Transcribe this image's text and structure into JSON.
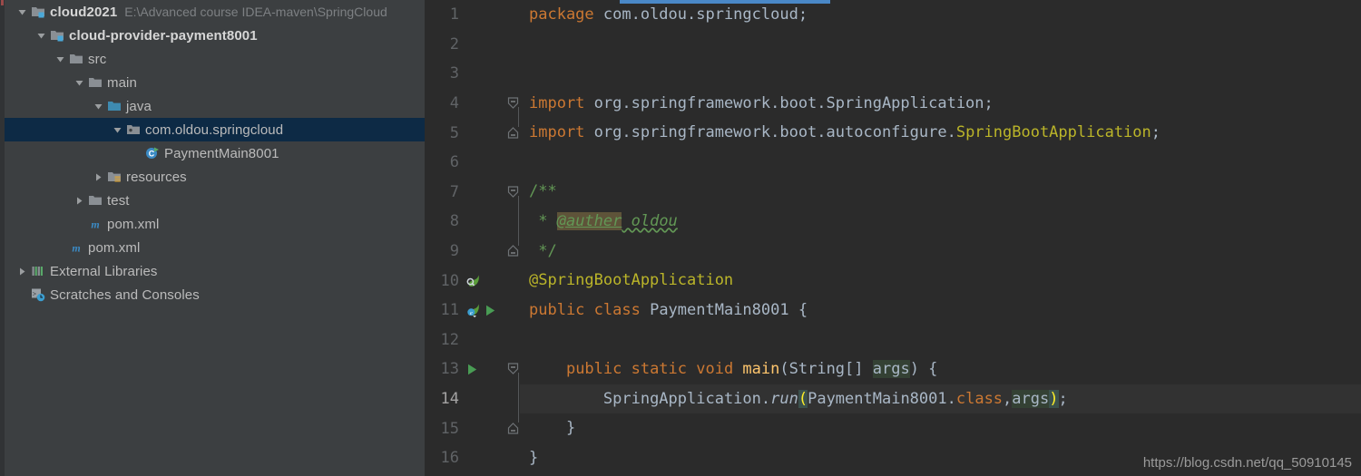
{
  "project_tree": {
    "items": [
      {
        "label": "cloud2021",
        "path": "E:\\Advanced course IDEA-maven\\SpringCloud",
        "icon": "module-folder-icon",
        "twisty": "expanded",
        "depth": 0,
        "bold": true,
        "selected": false
      },
      {
        "label": "cloud-provider-payment8001",
        "path": "",
        "icon": "module-folder-icon",
        "twisty": "expanded",
        "depth": 1,
        "bold": true,
        "selected": false
      },
      {
        "label": "src",
        "path": "",
        "icon": "folder-icon",
        "twisty": "expanded",
        "depth": 2,
        "bold": false,
        "selected": false
      },
      {
        "label": "main",
        "path": "",
        "icon": "folder-icon",
        "twisty": "expanded",
        "depth": 3,
        "bold": false,
        "selected": false
      },
      {
        "label": "java",
        "path": "",
        "icon": "source-root-folder-icon",
        "twisty": "expanded",
        "depth": 4,
        "bold": false,
        "selected": false
      },
      {
        "label": "com.oldou.springcloud",
        "path": "",
        "icon": "package-icon",
        "twisty": "expanded",
        "depth": 5,
        "bold": false,
        "selected": true
      },
      {
        "label": "PaymentMain8001",
        "path": "",
        "icon": "java-class-runnable-icon",
        "twisty": "none",
        "depth": 6,
        "bold": false,
        "selected": false
      },
      {
        "label": "resources",
        "path": "",
        "icon": "resources-folder-icon",
        "twisty": "collapsed",
        "depth": 4,
        "bold": false,
        "selected": false
      },
      {
        "label": "test",
        "path": "",
        "icon": "folder-icon",
        "twisty": "collapsed",
        "depth": 3,
        "bold": false,
        "selected": false
      },
      {
        "label": "pom.xml",
        "path": "",
        "icon": "maven-icon",
        "twisty": "none",
        "depth": 3,
        "bold": false,
        "selected": false
      },
      {
        "label": "pom.xml",
        "path": "",
        "icon": "maven-icon",
        "twisty": "none",
        "depth": 2,
        "bold": false,
        "selected": false
      },
      {
        "label": "External Libraries",
        "path": "",
        "icon": "libraries-icon",
        "twisty": "collapsed",
        "depth": 0,
        "bold": false,
        "selected": false
      },
      {
        "label": "Scratches and Consoles",
        "path": "",
        "icon": "scratches-icon",
        "twisty": "none",
        "depth": 0,
        "bold": false,
        "selected": false
      }
    ]
  },
  "editor": {
    "active_tab_indicator_color": "#4a88c7",
    "caret_line": 14,
    "lines": [
      {
        "n": "1",
        "gutter": [],
        "fold": "none"
      },
      {
        "n": "2",
        "gutter": [],
        "fold": "none"
      },
      {
        "n": "3",
        "gutter": [],
        "fold": "none"
      },
      {
        "n": "4",
        "gutter": [],
        "fold": "expanded-top"
      },
      {
        "n": "5",
        "gutter": [],
        "fold": "end"
      },
      {
        "n": "6",
        "gutter": [],
        "fold": "none"
      },
      {
        "n": "7",
        "gutter": [],
        "fold": "expanded-top"
      },
      {
        "n": "8",
        "gutter": [],
        "fold": "none"
      },
      {
        "n": "9",
        "gutter": [],
        "fold": "end"
      },
      {
        "n": "10",
        "gutter": [
          "spring-bean-icon"
        ],
        "fold": "none"
      },
      {
        "n": "11",
        "gutter": [
          "spring-boot-config-icon",
          "run-gutter-icon"
        ],
        "fold": "none"
      },
      {
        "n": "12",
        "gutter": [],
        "fold": "none"
      },
      {
        "n": "13",
        "gutter": [
          "run-gutter-icon"
        ],
        "fold": "expanded-top"
      },
      {
        "n": "14",
        "gutter": [],
        "fold": "none"
      },
      {
        "n": "15",
        "gutter": [],
        "fold": "end"
      },
      {
        "n": "16",
        "gutter": [],
        "fold": "none"
      }
    ],
    "code": {
      "l1_package_kw": "package",
      "l1_name": " com.oldou.springcloud;",
      "l4_import_kw": "import",
      "l4_rest": " org.springframework.boot.SpringApplication;",
      "l5_import_kw": "import",
      "l5_rest": " org.springframework.boot.autoconfigure.",
      "l5_type": "SpringBootApplication",
      "l5_semi": ";",
      "l7_comment": "/**",
      "l8_star": " * ",
      "l8_tag": "@auther",
      "l8_author": " oldou",
      "l9_comment": " */",
      "l10_annotation": "@SpringBootApplication",
      "l11_public": "public",
      "l11_class_kw": " class ",
      "l11_classname": "PaymentMain8001",
      "l11_brace": " {",
      "l13_indent": "    ",
      "l13_mods": "public static void ",
      "l13_method": "main",
      "l13_paren_open": "(",
      "l13_type": "String[] ",
      "l13_arg": "args",
      "l13_paren_close": ") {",
      "l14_indent": "        ",
      "l14_class": "SpringApplication.",
      "l14_call": "run",
      "l14_open": "(",
      "l14_arg1": "PaymentMain8001.",
      "l14_classkw": "class",
      "l14_comma": ",",
      "l14_arg2": "args",
      "l14_close": ")",
      "l14_semi": ";",
      "l15_brace": "    }",
      "l16_brace": "}"
    },
    "watermark": "https://blog.csdn.net/qq_50910145"
  }
}
